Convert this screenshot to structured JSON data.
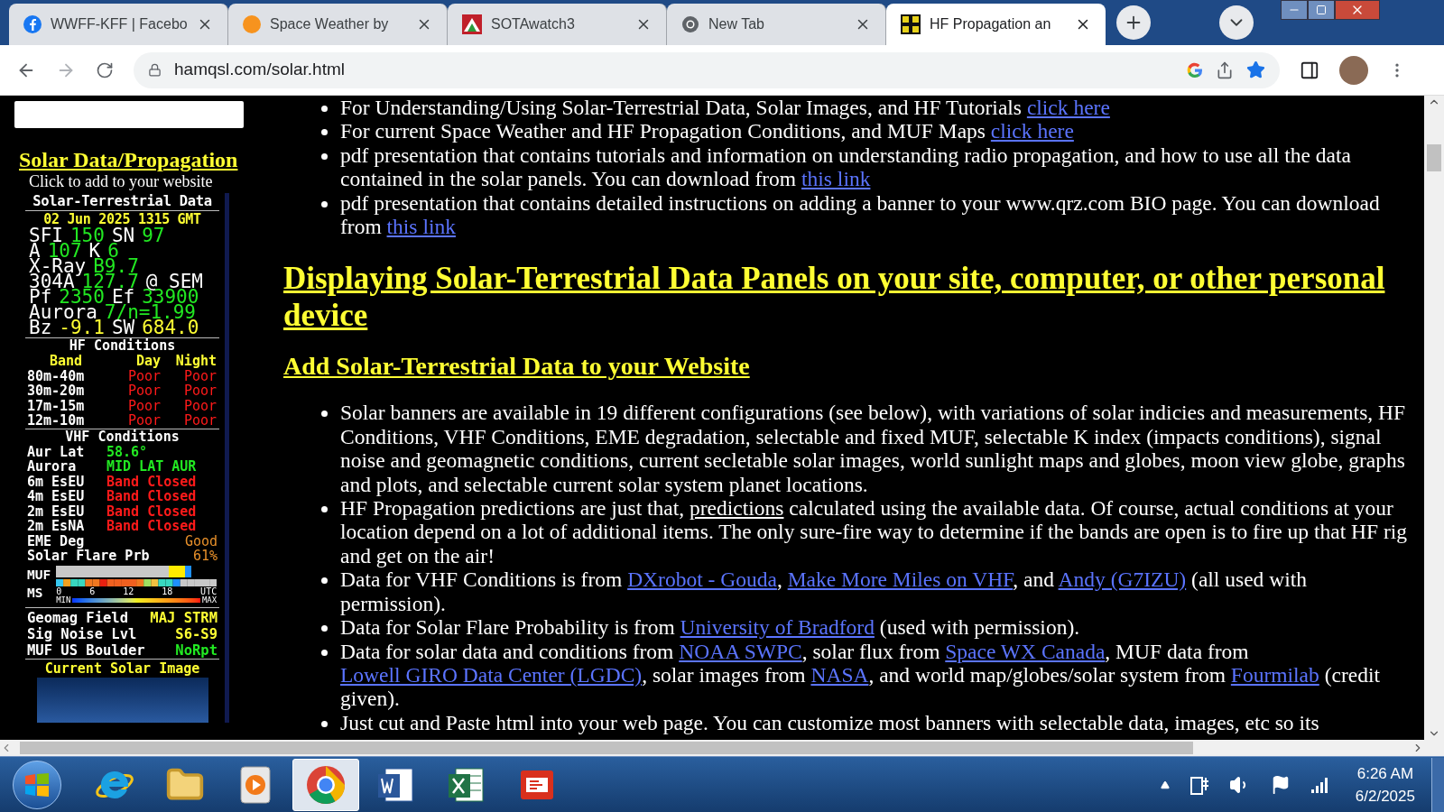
{
  "tabs": [
    {
      "title": "WWFF-KFF | Facebo",
      "kind": "facebook",
      "selected": false
    },
    {
      "title": "Space Weather by",
      "kind": "sun",
      "selected": false
    },
    {
      "title": "SOTAwatch3",
      "kind": "mountain",
      "selected": false
    },
    {
      "title": "New Tab",
      "kind": "chrome",
      "selected": false
    },
    {
      "title": "HF Propagation an",
      "kind": "grid",
      "selected": true
    }
  ],
  "address": "hamqsl.com/solar.html",
  "sidebar": {
    "title": "Solar Data/Propagation",
    "subtitle": "Click to add to your website",
    "banner": {
      "title": "Solar-Terrestrial Data",
      "date": "02 Jun 2025 1315 GMT",
      "solar_rows": [
        [
          {
            "text": "SFI",
            "color": "#ffffff"
          },
          {
            "text": "150",
            "color": "#22e822"
          },
          {
            "text": "SN",
            "color": "#ffffff"
          },
          {
            "text": "97",
            "color": "#22e822"
          }
        ],
        [
          {
            "text": "A",
            "color": "#ffffff"
          },
          {
            "text": "107",
            "color": "#22e822"
          },
          {
            "text": "K",
            "color": "#ffffff"
          },
          {
            "text": "6",
            "color": "#22e822"
          }
        ],
        [
          {
            "text": "X-Ray",
            "color": "#ffffff"
          },
          {
            "text": "B9.7",
            "color": "#22e822"
          }
        ],
        [
          {
            "text": "304A",
            "color": "#ffffff"
          },
          {
            "text": "127.7",
            "color": "#22e822"
          },
          {
            "text": "@ SEM",
            "color": "#ffffff"
          }
        ],
        [
          {
            "text": "Pf",
            "color": "#ffffff"
          },
          {
            "text": "2350",
            "color": "#22e822"
          },
          {
            "text": "Ef",
            "color": "#ffffff"
          },
          {
            "text": "33900",
            "color": "#22e822"
          }
        ],
        [
          {
            "text": "Aurora",
            "color": "#ffffff"
          },
          {
            "text": "7/n=1.99",
            "color": "#22e822"
          }
        ],
        [
          {
            "text": "Bz",
            "color": "#ffffff"
          },
          {
            "text": "-9.1",
            "color": "#ffff33"
          },
          {
            "text": "SW",
            "color": "#ffffff"
          },
          {
            "text": "684.0",
            "color": "#ffff33"
          }
        ]
      ],
      "hf_title": "HF Conditions",
      "hf_columns": [
        "Band",
        "Day",
        "Night"
      ],
      "hf_rows": [
        {
          "band": "80m-40m",
          "day": {
            "text": "Poor",
            "color": "#ff1a1a"
          },
          "night": {
            "text": "Poor",
            "color": "#ff1a1a"
          }
        },
        {
          "band": "30m-20m",
          "day": {
            "text": "Poor",
            "color": "#ff1a1a"
          },
          "night": {
            "text": "Poor",
            "color": "#ff1a1a"
          }
        },
        {
          "band": "17m-15m",
          "day": {
            "text": "Poor",
            "color": "#ff1a1a"
          },
          "night": {
            "text": "Poor",
            "color": "#ff1a1a"
          }
        },
        {
          "band": "12m-10m",
          "day": {
            "text": "Poor",
            "color": "#ff1a1a"
          },
          "night": {
            "text": "Poor",
            "color": "#ff1a1a"
          }
        }
      ],
      "vhf_title": "VHF Conditions",
      "vhf_rows": [
        {
          "label": "Aur Lat",
          "value": "58.6°",
          "color": "#22e822"
        },
        {
          "label": "Aurora",
          "value": "MID LAT AUR",
          "color": "#22e822"
        },
        {
          "label": "6m EsEU",
          "value": "Band Closed",
          "color": "#ff1a1a"
        },
        {
          "label": "4m EsEU",
          "value": "Band Closed",
          "color": "#ff1a1a"
        },
        {
          "label": "2m EsEU",
          "value": "Band Closed",
          "color": "#ff1a1a"
        },
        {
          "label": "2m EsNA",
          "value": "Band Closed",
          "color": "#ff1a1a"
        },
        {
          "label": "EME Deg",
          "value": "Good",
          "color": "#e8902a"
        },
        {
          "label": "Solar Flare Prb",
          "value": "61%",
          "color": "#e8902a"
        }
      ],
      "muf_label": "MUF",
      "ms_label": "MS",
      "scale_labels": [
        "0",
        "6",
        "12",
        "18"
      ],
      "utc": "UTC",
      "min": "MIN",
      "max": "MAX",
      "geo_rows": [
        {
          "label": "Geomag Field",
          "value": "MAJ STRM",
          "color": "#ffff33"
        },
        {
          "label": "Sig Noise Lvl",
          "value": "S6-S9",
          "color": "#ffff33"
        },
        {
          "label": "MUF US Boulder",
          "value": "NoRpt",
          "color": "#22e822"
        }
      ],
      "image_caption": "Current Solar Image"
    }
  },
  "content": {
    "intro_bullets": [
      [
        {
          "text": "For Understanding/Using Solar-Terrestrial Data, Solar Images, and HF Tutorials "
        },
        {
          "link": "click here"
        }
      ],
      [
        {
          "text": "For current Space Weather and HF Propagation Conditions, and MUF Maps "
        },
        {
          "link": "click here"
        }
      ],
      [
        {
          "text": "pdf presentation that contains tutorials and information on understanding radio propagation, and how to use all the data contained in the solar panels. You can download from "
        },
        {
          "link": "this link"
        }
      ],
      [
        {
          "text": "pdf presentation that contains detailed instructions on adding a banner to your www.qrz.com BIO page. You can download from "
        },
        {
          "link": "this link"
        }
      ]
    ],
    "heading": "Displaying Solar-Terrestrial Data Panels on your site, computer, or other personal device",
    "subheading": "Add Solar-Terrestrial Data to your Website",
    "bullets": [
      [
        {
          "text": "Solar banners are available in 19 different configurations (see below), with variations of solar indicies and measurements, HF Conditions, VHF Conditions, EME degradation, selectable and fixed MUF, selectable K index (impacts conditions), signal noise and geomagnetic conditions, current secletable solar images, world sunlight maps and globes, moon view globe, graphs and plots, and selectable current solar system planet locations."
        }
      ],
      [
        {
          "text": "HF Propagation predictions are just that, "
        },
        {
          "underline": "predictions"
        },
        {
          "text": " calculated using the available data. Of course, actual conditions at your location depend on a lot of additional items. The only sure-fire way to determine if the bands are open is to fire up that HF rig and get on the air!"
        }
      ],
      [
        {
          "text": "Data for VHF Conditions is from "
        },
        {
          "link": "DXrobot - Gouda"
        },
        {
          "text": ", "
        },
        {
          "link": "Make More Miles on VHF"
        },
        {
          "text": ", and "
        },
        {
          "link": "Andy (G7IZU)"
        },
        {
          "text": " (all used with permission)."
        }
      ],
      [
        {
          "text": "Data for Solar Flare Probability is from "
        },
        {
          "link": "University of Bradford"
        },
        {
          "text": " (used with permission)."
        }
      ],
      [
        {
          "text": "Data for solar data and conditions from "
        },
        {
          "link": "NOAA SWPC"
        },
        {
          "text": ", solar flux from "
        },
        {
          "link": "Space WX Canada"
        },
        {
          "text": ", MUF data from "
        },
        {
          "link": "Lowell GIRO Data Center (LGDC)"
        },
        {
          "text": ", solar images from "
        },
        {
          "link": "NASA"
        },
        {
          "text": ", and world map/globes/solar system from "
        },
        {
          "link": "Fourmilab"
        },
        {
          "text": " (credit given)."
        }
      ],
      [
        {
          "text": "Just cut and Paste html into your web page. You can customize most banners with selectable data, images, etc so its"
        }
      ]
    ]
  },
  "taskbar": {
    "apps": [
      {
        "kind": "ie",
        "selected": false
      },
      {
        "kind": "folder",
        "selected": false
      },
      {
        "kind": "media",
        "selected": false
      },
      {
        "kind": "chrome",
        "selected": true
      },
      {
        "kind": "word",
        "selected": false
      },
      {
        "kind": "excel",
        "selected": false
      },
      {
        "kind": "reader",
        "selected": false
      }
    ],
    "time": "6:26 AM",
    "date": "6/2/2025"
  }
}
